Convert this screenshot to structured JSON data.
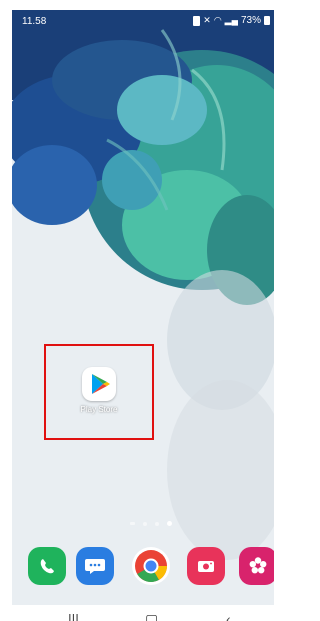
{
  "status_bar": {
    "time": "11.58",
    "battery_percent": "73%"
  },
  "home_screen": {
    "apps": [
      {
        "label": "Play Store",
        "icon": "google-play-icon"
      }
    ]
  },
  "page_indicator": {
    "count": 4,
    "active_index": 3
  },
  "dock": [
    {
      "icon": "phone-icon",
      "color": "#1fb35c"
    },
    {
      "icon": "messages-icon",
      "color": "#2a7de1"
    },
    {
      "icon": "chrome-icon",
      "color": "#ffffff"
    },
    {
      "icon": "camera-icon",
      "color": "#e8335a"
    },
    {
      "icon": "gallery-icon",
      "color": "#d8236c"
    }
  ],
  "nav_bar": {
    "recents_icon": "recents-icon",
    "home_icon": "home-icon",
    "back_icon": "back-icon"
  },
  "colors": {
    "highlight": "#e01010",
    "wallpaper_teal": "#2f8f8a",
    "wallpaper_blue": "#1f4f95",
    "wallpaper_light": "#e9eef2"
  }
}
